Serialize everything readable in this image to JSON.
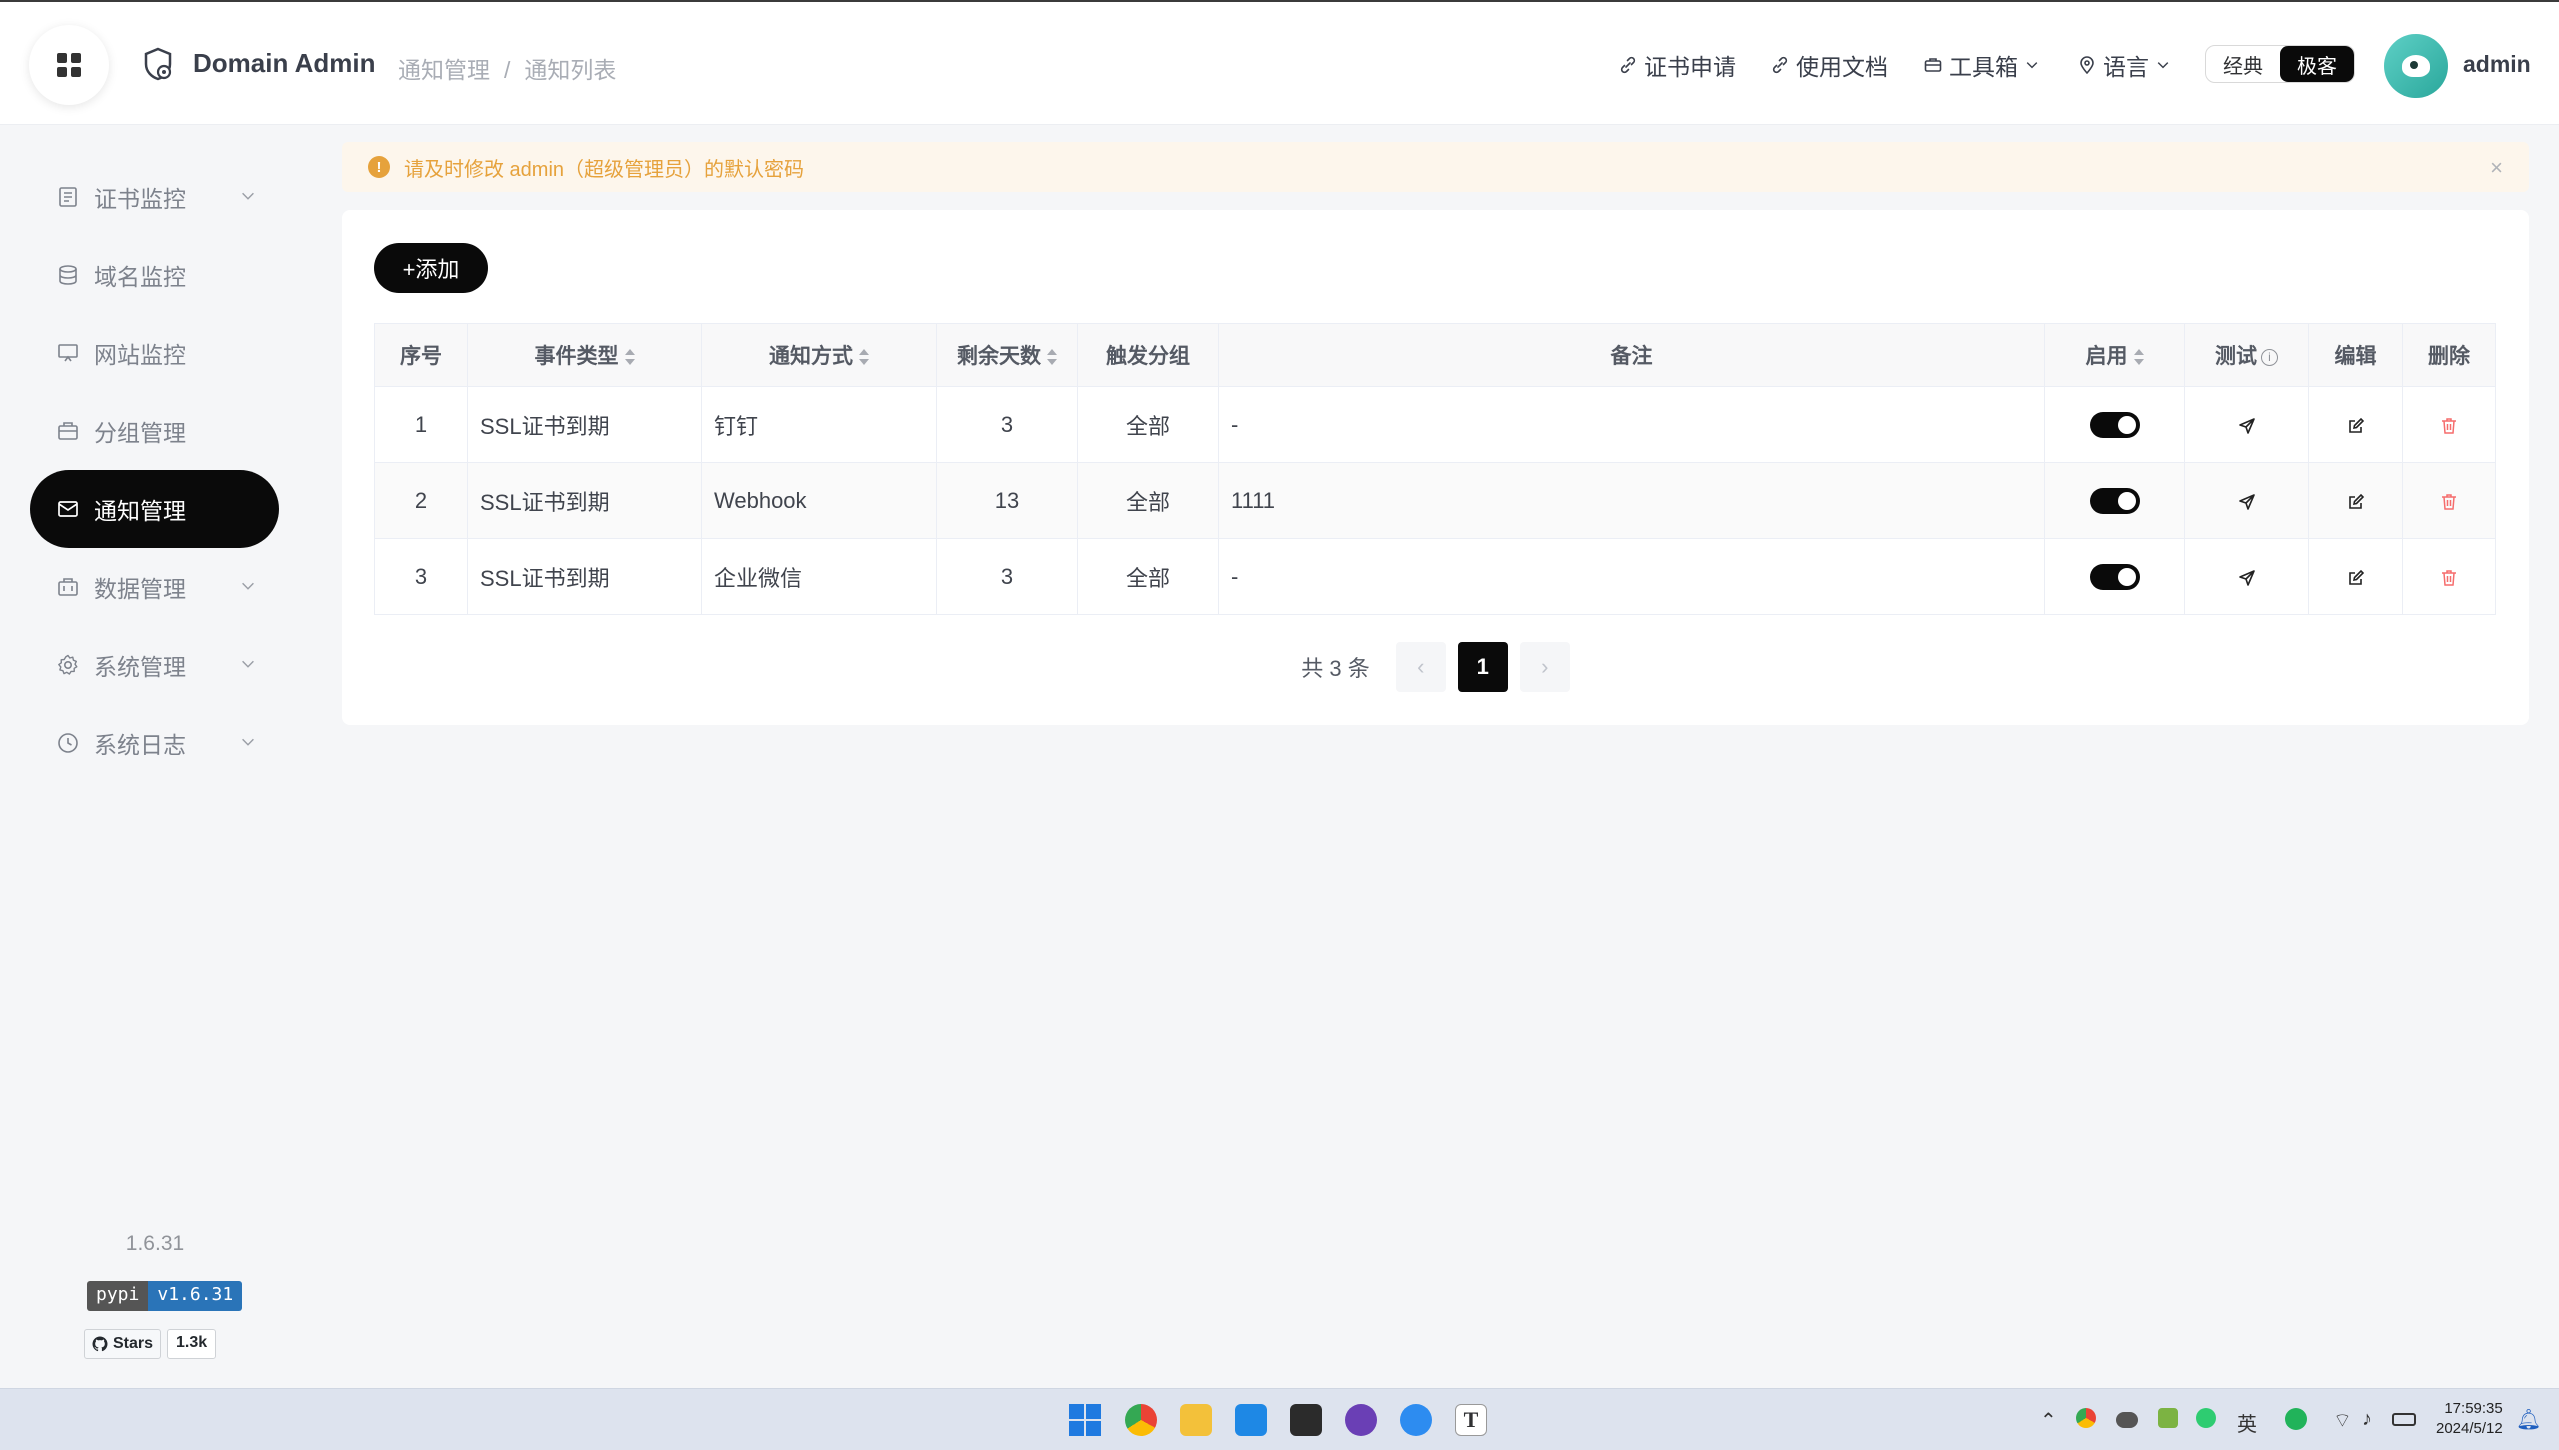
{
  "header": {
    "app_title": "Domain Admin",
    "breadcrumb": [
      "通知管理",
      "通知列表"
    ],
    "breadcrumb_sep": "/",
    "nav": [
      {
        "label": "证书申请"
      },
      {
        "label": "使用文档"
      },
      {
        "label": "工具箱"
      },
      {
        "label": "语言"
      }
    ],
    "mode_options": [
      "经典",
      "极客"
    ],
    "mode_selected": "极客",
    "username": "admin"
  },
  "sidebar": {
    "items": [
      {
        "label": "证书监控",
        "icon": "document-icon"
      },
      {
        "label": "域名监控",
        "icon": "database-icon"
      },
      {
        "label": "网站监控",
        "icon": "monitor-icon"
      },
      {
        "label": "分组管理",
        "icon": "briefcase-icon"
      },
      {
        "label": "通知管理",
        "icon": "mail-icon"
      },
      {
        "label": "数据管理",
        "icon": "suitcase-icon"
      },
      {
        "label": "系统管理",
        "icon": "gear-icon"
      },
      {
        "label": "系统日志",
        "icon": "clock-icon"
      }
    ],
    "active": "通知管理",
    "version": "1.6.31",
    "pypi_label": "pypi",
    "pypi_version": "v1.6.31",
    "github_label": "Stars",
    "github_count": "1.3k"
  },
  "alert": {
    "text": "请及时修改 admin（超级管理员）的默认密码",
    "close": "×"
  },
  "toolbar": {
    "add_label": "+添加"
  },
  "table": {
    "columns": [
      "序号",
      "事件类型",
      "通知方式",
      "剩余天数",
      "触发分组",
      "备注",
      "启用",
      "测试",
      "编辑",
      "删除"
    ],
    "rows": [
      {
        "index": "1",
        "event": "SSL证书到期",
        "method": "钉钉",
        "days": "3",
        "group": "全部",
        "note": "-",
        "enabled": true
      },
      {
        "index": "2",
        "event": "SSL证书到期",
        "method": "Webhook",
        "days": "13",
        "group": "全部",
        "note": "1111",
        "enabled": true
      },
      {
        "index": "3",
        "event": "SSL证书到期",
        "method": "企业微信",
        "days": "3",
        "group": "全部",
        "note": "-",
        "enabled": true
      }
    ]
  },
  "pagination": {
    "total": "共 3 条",
    "prev": "‹",
    "current": "1",
    "next": "›"
  },
  "taskbar": {
    "ime": "英",
    "time": "17:59:35",
    "date": "2024/5/12"
  },
  "colors": {
    "accent": "#0a0a0a",
    "warning": "#e6a23c",
    "warning_bg": "#fdf6ec",
    "danger": "#f56c6c"
  }
}
